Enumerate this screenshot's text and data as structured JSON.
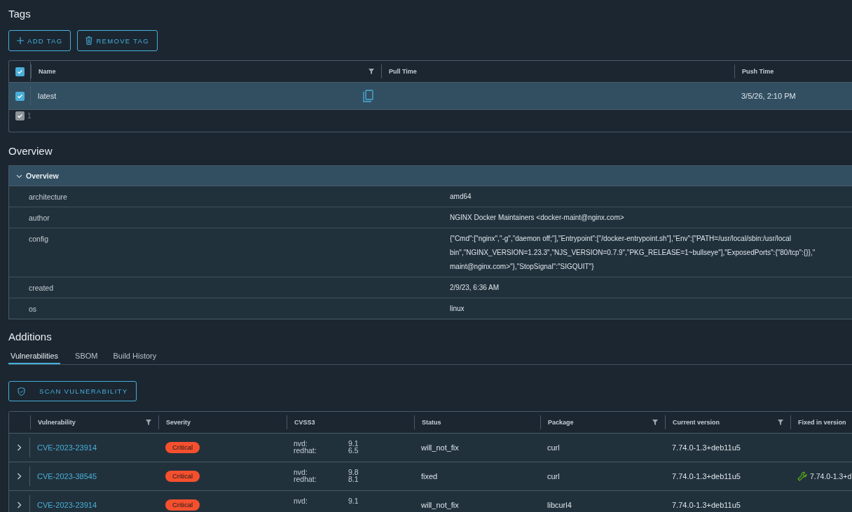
{
  "tags": {
    "title": "Tags",
    "buttons": [
      {
        "kind": "add",
        "label": "ADD TAG"
      },
      {
        "kind": "remove",
        "label": "REMOVE TAG"
      }
    ],
    "table": {
      "all_checked": true,
      "columns": [
        {
          "label": "Name",
          "filter": true
        },
        {
          "label": "Pull Time",
          "filter": false
        },
        {
          "label": "Push Time"
        }
      ],
      "rows": [
        {
          "name": "latest",
          "push_time": "3/5/26, 2:10 PM",
          "checked": true,
          "selected": true
        }
      ],
      "footer_count": "1"
    }
  },
  "overview": {
    "title": "Overview",
    "panel_title": "Overview",
    "expanded": true,
    "rows": [
      {
        "key": "architecture",
        "value": [
          "amd64"
        ]
      },
      {
        "key": "author",
        "value": [
          "NGINX Docker Maintainers <docker-maint@nginx.com>"
        ]
      },
      {
        "key": "config",
        "value": [
          "{\"Cmd\":[\"nginx\",\"-g\",\"daemon off;\"],\"Entrypoint\":[\"/docker-entrypoint.sh\"],\"Env\":[\"PATH=/usr/local/sbin:/usr/local",
          "bin\",\"NGINX_VERSION=1.23.3\",\"NJS_VERSION=0.7.9\",\"PKG_RELEASE=1~bullseye\"],\"ExposedPorts\":{\"80/tcp\":{}},\"",
          "maint@nginx.com>\"},\"StopSignal\":\"SIGQUIT\"}"
        ]
      },
      {
        "key": "created",
        "value": [
          "2/9/23, 6:36 AM"
        ]
      },
      {
        "key": "os",
        "value": [
          "linux"
        ]
      }
    ]
  },
  "additions": {
    "title": "Additions",
    "tabs": [
      {
        "label": "Vulnerabilities",
        "selected": true
      },
      {
        "label": "SBOM",
        "selected": false
      },
      {
        "label": "Build History",
        "selected": false
      }
    ],
    "scan_button": "SCAN VULNERABILITY",
    "columns": [
      {
        "label": "Vulnerability",
        "filter": true
      },
      {
        "label": "Severity",
        "filter": false
      },
      {
        "label": "CVSS3",
        "filter": false
      },
      {
        "label": "Status",
        "filter": false
      },
      {
        "label": "Package",
        "filter": true
      },
      {
        "label": "Current version",
        "filter": true
      },
      {
        "label": "Fixed in version"
      }
    ],
    "rows": [
      {
        "id": "CVE-2023-23914",
        "severity": "Critical",
        "color": "#f5502e",
        "cvss": [
          {
            "source": "nvd:",
            "score": "9.1"
          },
          {
            "source": "redhat:",
            "score": "6.5"
          }
        ],
        "status": "will_not_fix",
        "package": "curl",
        "current": "7.74.0-1.3+deb11u5"
      },
      {
        "id": "CVE-2023-38545",
        "severity": "Critical",
        "color": "#f5502e",
        "cvss": [
          {
            "source": "nvd:",
            "score": "9.8"
          },
          {
            "source": "redhat:",
            "score": "8.1"
          }
        ],
        "status": "fixed",
        "package": "curl",
        "current": "7.74.0-1.3+deb11u5",
        "fixed": "7.74.0-1.3+d"
      },
      {
        "id": "CVE-2023-23914",
        "severity": "Critical",
        "color": "#f5502e",
        "cvss": [
          {
            "source": "nvd:",
            "score": "9.1"
          }
        ],
        "status": "will_not_fix",
        "package": "libcurl4",
        "current": "7.74.0-1.3+deb11u5"
      }
    ]
  }
}
